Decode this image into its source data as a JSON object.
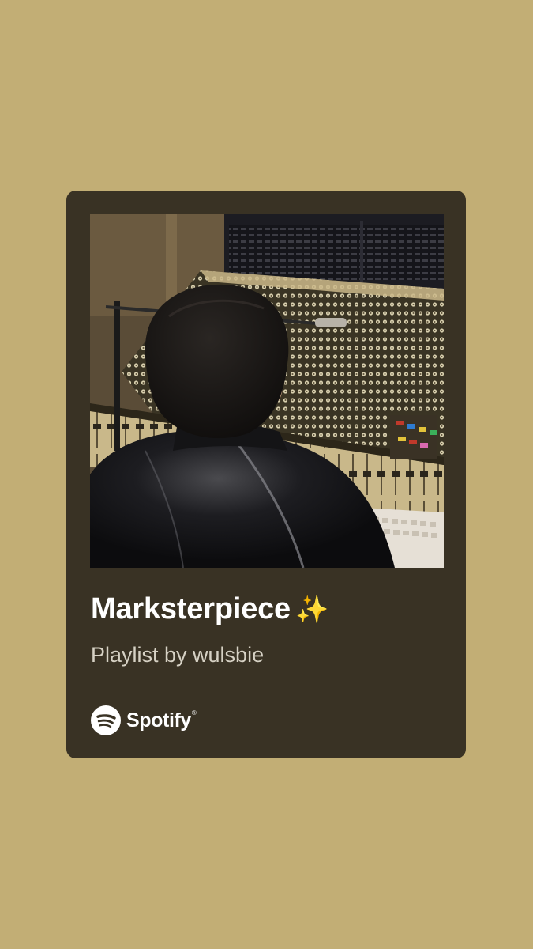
{
  "share_card": {
    "playlist_title": "Marksterpiece",
    "title_emoji": "✨",
    "subtitle": "Playlist by wulsbie",
    "brand": {
      "icon": "spotify-icon",
      "name": "Spotify",
      "trademark": "®"
    },
    "cover_art": {
      "icon": "studio-mixing-console-photo"
    }
  },
  "colors": {
    "page_background": "#c2ae75",
    "card_background": "#393224",
    "title_text": "#ffffff",
    "subtitle_text": "#d6d1c4",
    "sparkles": "#f4c400"
  }
}
